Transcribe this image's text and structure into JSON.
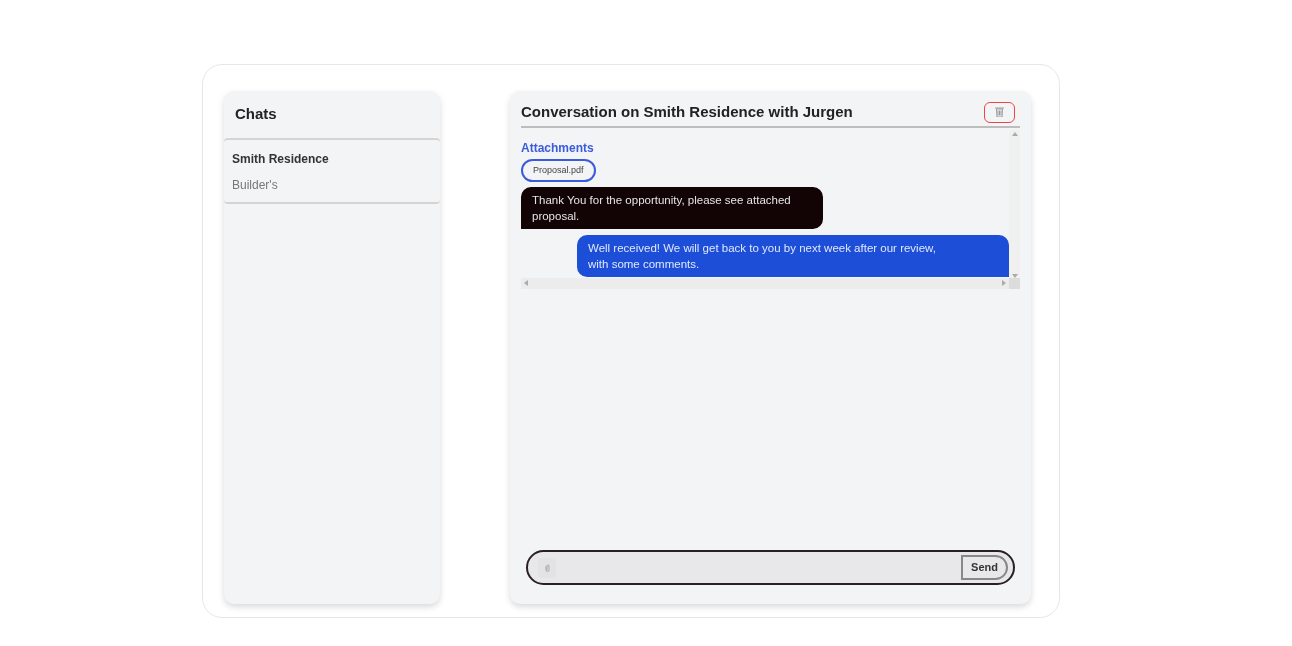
{
  "sidebar": {
    "title": "Chats",
    "items": [
      {
        "name": "Smith Residence",
        "subtitle": "Builder's"
      }
    ]
  },
  "conversation": {
    "title": "Conversation on Smith Residence with Jurgen",
    "attachments_label": "Attachments",
    "attachments": [
      "Proposal.pdf"
    ],
    "messages": [
      {
        "kind": "received",
        "text": "Thank You for the opportunity, please see attached proposal."
      },
      {
        "kind": "sent",
        "text": "Well received! We will get back to you by next week after our review, with some comments."
      }
    ]
  },
  "composer": {
    "send": "Send"
  }
}
